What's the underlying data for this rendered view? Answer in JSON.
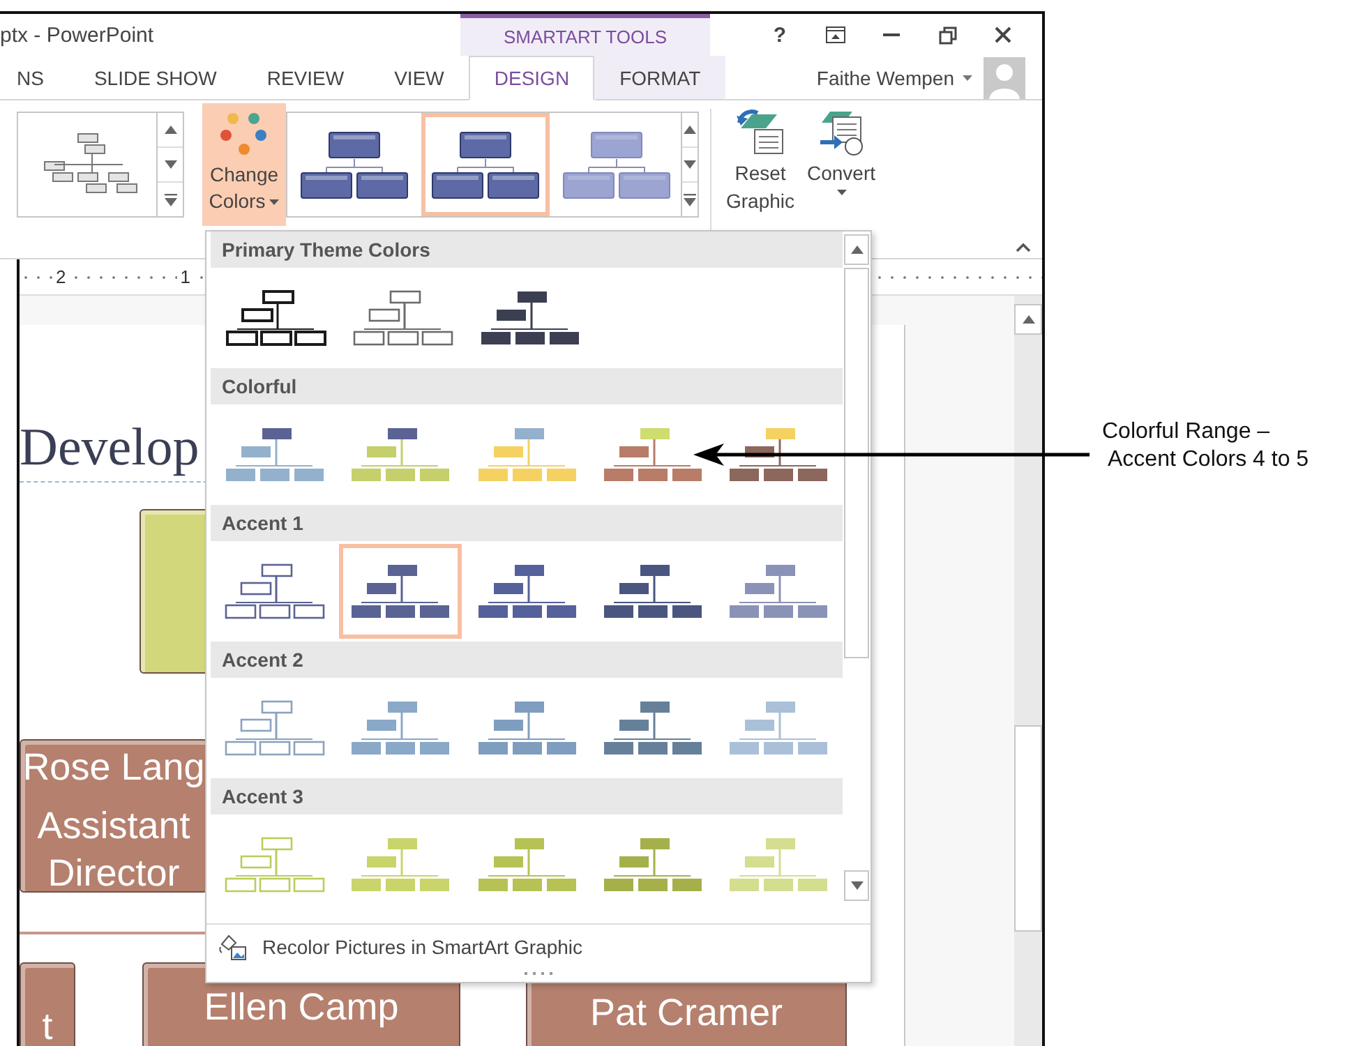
{
  "window": {
    "title": "ptx - PowerPoint",
    "contextual_group": "SMARTART TOOLS",
    "help": "?",
    "user": "Faithe Wempen"
  },
  "tabs": [
    {
      "label": "NS",
      "selected": false,
      "contextual": false
    },
    {
      "label": "SLIDE SHOW",
      "selected": false,
      "contextual": false
    },
    {
      "label": "REVIEW",
      "selected": false,
      "contextual": false
    },
    {
      "label": "VIEW",
      "selected": false,
      "contextual": false
    },
    {
      "label": "DESIGN",
      "selected": true,
      "contextual": true
    },
    {
      "label": "FORMAT",
      "selected": false,
      "contextual": true
    }
  ],
  "ribbon": {
    "change_colors": {
      "label": "Change Colors",
      "open": true
    },
    "styles": [
      {
        "kind": "bevel",
        "selected": false
      },
      {
        "kind": "bevel",
        "selected": true
      },
      {
        "kind": "flat",
        "selected": false
      }
    ],
    "reset": {
      "label": "Reset Graphic"
    },
    "convert": {
      "label": "Convert"
    }
  },
  "ruler": [
    "2",
    "1"
  ],
  "slide": {
    "title": "Develop",
    "shapes": [
      {
        "kind": "blank",
        "color": "#d2d77c"
      },
      {
        "kind": "person",
        "color": "#b5806e",
        "name": "Rose Lang",
        "role": "Assistant Director"
      },
      {
        "kind": "person",
        "color": "#b5806e",
        "name": "t"
      },
      {
        "kind": "person",
        "color": "#b5806e",
        "name": "Ellen Camp"
      },
      {
        "kind": "person",
        "color": "#b5806e",
        "name": "Pat Cramer"
      }
    ]
  },
  "color_menu": {
    "sections": [
      {
        "title": "Primary Theme Colors",
        "items": [
          {
            "kind": "outline",
            "color": "#1a1a1a",
            "selected": false
          },
          {
            "kind": "outline",
            "color": "#6b6b6b",
            "selected": false
          },
          {
            "kind": "filled",
            "color": "#3c3f52",
            "selected": false
          }
        ]
      },
      {
        "title": "Colorful",
        "items": [
          {
            "kind": "filled",
            "color": "#93b1cc",
            "top": {
              "color": "#5a6394"
            },
            "selected": false
          },
          {
            "kind": "filled",
            "color": "#c5cf6b",
            "top": {
              "color": "#5a6394"
            },
            "selected": false
          },
          {
            "kind": "filled",
            "color": "#f5d161",
            "top": {
              "color": "#93b1cc"
            },
            "selected": false
          },
          {
            "kind": "filled",
            "color": "#b87c68",
            "top": {
              "color": "#cfdc6e"
            },
            "selected": false
          },
          {
            "kind": "filled",
            "color": "#8c675c",
            "top": {
              "color": "#f5d161"
            },
            "selected": false
          }
        ]
      },
      {
        "title": "Accent 1",
        "items": [
          {
            "kind": "outline",
            "color": "#5a6394",
            "selected": false
          },
          {
            "kind": "filled",
            "color": "#5a6394",
            "selected": true
          },
          {
            "kind": "filled",
            "color": "#55619a",
            "selected": false
          },
          {
            "kind": "filled",
            "color": "#4a5580",
            "selected": false
          },
          {
            "kind": "filled",
            "color": "#8a92b8",
            "selected": false
          }
        ]
      },
      {
        "title": "Accent 2",
        "items": [
          {
            "kind": "outline",
            "color": "#8aa2bd",
            "selected": false
          },
          {
            "kind": "filled",
            "color": "#8aa8c8",
            "selected": false
          },
          {
            "kind": "filled",
            "color": "#7f9ebf",
            "selected": false
          },
          {
            "kind": "filled",
            "color": "#66809a",
            "selected": false
          },
          {
            "kind": "filled",
            "color": "#a9c0d8",
            "selected": false
          }
        ]
      },
      {
        "title": "Accent 3",
        "items": [
          {
            "kind": "outline",
            "color": "#bccc5b",
            "selected": false
          },
          {
            "kind": "filled",
            "color": "#c9d46a",
            "selected": false
          },
          {
            "kind": "filled",
            "color": "#b6c254",
            "selected": false
          },
          {
            "kind": "filled",
            "color": "#a5b04a",
            "selected": false
          },
          {
            "kind": "filled",
            "color": "#d5dd8f",
            "selected": false
          }
        ]
      }
    ],
    "footer": "Recolor Pictures in SmartArt Graphic"
  },
  "callout": {
    "lines": [
      "Colorful Range –",
      "Accent Colors 4 to 5"
    ]
  }
}
